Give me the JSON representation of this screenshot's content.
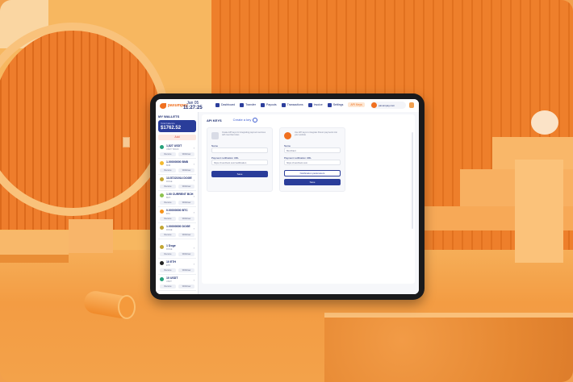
{
  "topbar": {
    "logo_text": "paxumpay",
    "date": "Jan 05",
    "time": "11:27:25",
    "nav": [
      {
        "label": "Dashboard",
        "active": false
      },
      {
        "label": "Transfer",
        "active": false
      },
      {
        "label": "Payouts",
        "active": false
      },
      {
        "label": "Transactions",
        "active": false
      },
      {
        "label": "Invoice",
        "active": false
      },
      {
        "label": "Settings",
        "active": false
      },
      {
        "label": "API Keys",
        "active": true
      }
    ],
    "user_name": "paxumpay.com"
  },
  "sidebar": {
    "title": "MY WALLETS",
    "balance_label": "Total balance",
    "balance_value": "$1762.52",
    "add_label": "Add",
    "wallets": [
      {
        "name": "1,827 USDT",
        "sub": "USDT TRC20",
        "pill1": "Receive",
        "pill2": "Withdraw",
        "color": "#26a17b"
      },
      {
        "name": "1.00000000 BNB",
        "sub": "BNB",
        "pill1": "Receive",
        "pill2": "Withdraw",
        "color": "#f3ba2f"
      },
      {
        "name": "13.57221914 DOGE",
        "sub": "DOGE",
        "pill1": "Receive",
        "pill2": "Withdraw",
        "color": "#c2a633"
      },
      {
        "name": "1.00 CURRENT BCH",
        "sub": "BCH",
        "pill1": "Receive",
        "pill2": "Withdraw",
        "color": "#8dc351"
      },
      {
        "name": "0.00000000 BTC",
        "sub": "BTC",
        "pill1": "Receive",
        "pill2": "Withdraw",
        "color": "#f7931a"
      },
      {
        "name": "1.00000000 DOGE",
        "sub": "DOGE",
        "pill1": "Receive",
        "pill2": "Withdraw",
        "color": "#c2a633"
      },
      {
        "name": "1 Doge",
        "sub": "DOGE",
        "pill1": "Receive",
        "pill2": "Withdraw",
        "color": "#c2a633"
      },
      {
        "name": "10 ETH",
        "sub": "ETH",
        "pill1": "Receive",
        "pill2": "Withdraw",
        "color": "#222"
      },
      {
        "name": "10 USDT",
        "sub": "USDT",
        "pill1": "Receive",
        "pill2": "Withdraw",
        "color": "#26a17b"
      }
    ]
  },
  "main": {
    "tab_title": "API KEYS",
    "tab_link": "Create a key",
    "card1": {
      "desc": "Create API keys for integrating payment services with merchant sites",
      "label_name": "Name",
      "label_url": "Payment notification URL",
      "url_value": "https://merchant.com/notification",
      "button": "Save"
    },
    "card2": {
      "desc": "Use API keys to integrate Paxum payments into your website",
      "label_name": "Name",
      "name_value": "Merchant",
      "label_url": "Payment notification URL",
      "url_value": "https://merchant.com",
      "outline_button": "Notification parameters",
      "button": "Save"
    }
  },
  "colors": {
    "accent": "#2a3d9a",
    "brand": "#f07020"
  }
}
